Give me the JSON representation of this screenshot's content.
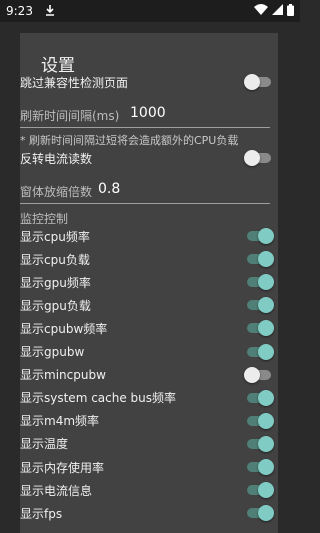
{
  "status_bar": {
    "time": "9:23",
    "icons": [
      "download-icon",
      "wifi-icon",
      "signal-icon",
      "battery-icon"
    ]
  },
  "dialog": {
    "title": "设置",
    "skip_compat": {
      "label": "跳过兼容性检测页面",
      "on": false
    },
    "refresh": {
      "label": "刷新时间间隔(ms)",
      "value": "1000"
    },
    "note": "* 刷新时间间隔过短将会造成额外的CPU负载",
    "reverse_current": {
      "label": "反转电流读数",
      "on": false
    },
    "scale": {
      "label": "窗体放缩倍数",
      "value": "0.8"
    },
    "section": "监控控制",
    "items": [
      {
        "label": "显示cpu频率",
        "on": true
      },
      {
        "label": "显示cpu负载",
        "on": true
      },
      {
        "label": "显示gpu频率",
        "on": true
      },
      {
        "label": "显示gpu负载",
        "on": true
      },
      {
        "label": "显示cpubw频率",
        "on": true
      },
      {
        "label": "显示gpubw",
        "on": true
      },
      {
        "label": "显示mincpubw",
        "on": false
      },
      {
        "label": "显示system cache bus频率",
        "on": true
      },
      {
        "label": "显示m4m频率",
        "on": true
      },
      {
        "label": "显示温度",
        "on": true
      },
      {
        "label": "显示内存使用率",
        "on": true
      },
      {
        "label": "显示电流信息",
        "on": true
      },
      {
        "label": "显示fps",
        "on": true
      }
    ]
  },
  "colors": {
    "switch_on_thumb": "#80cbc4",
    "switch_on_track": "#4f7f76",
    "switch_off_thumb": "#ececec",
    "switch_off_track": "#8a8a8a",
    "dialog_bg": "#424242"
  }
}
